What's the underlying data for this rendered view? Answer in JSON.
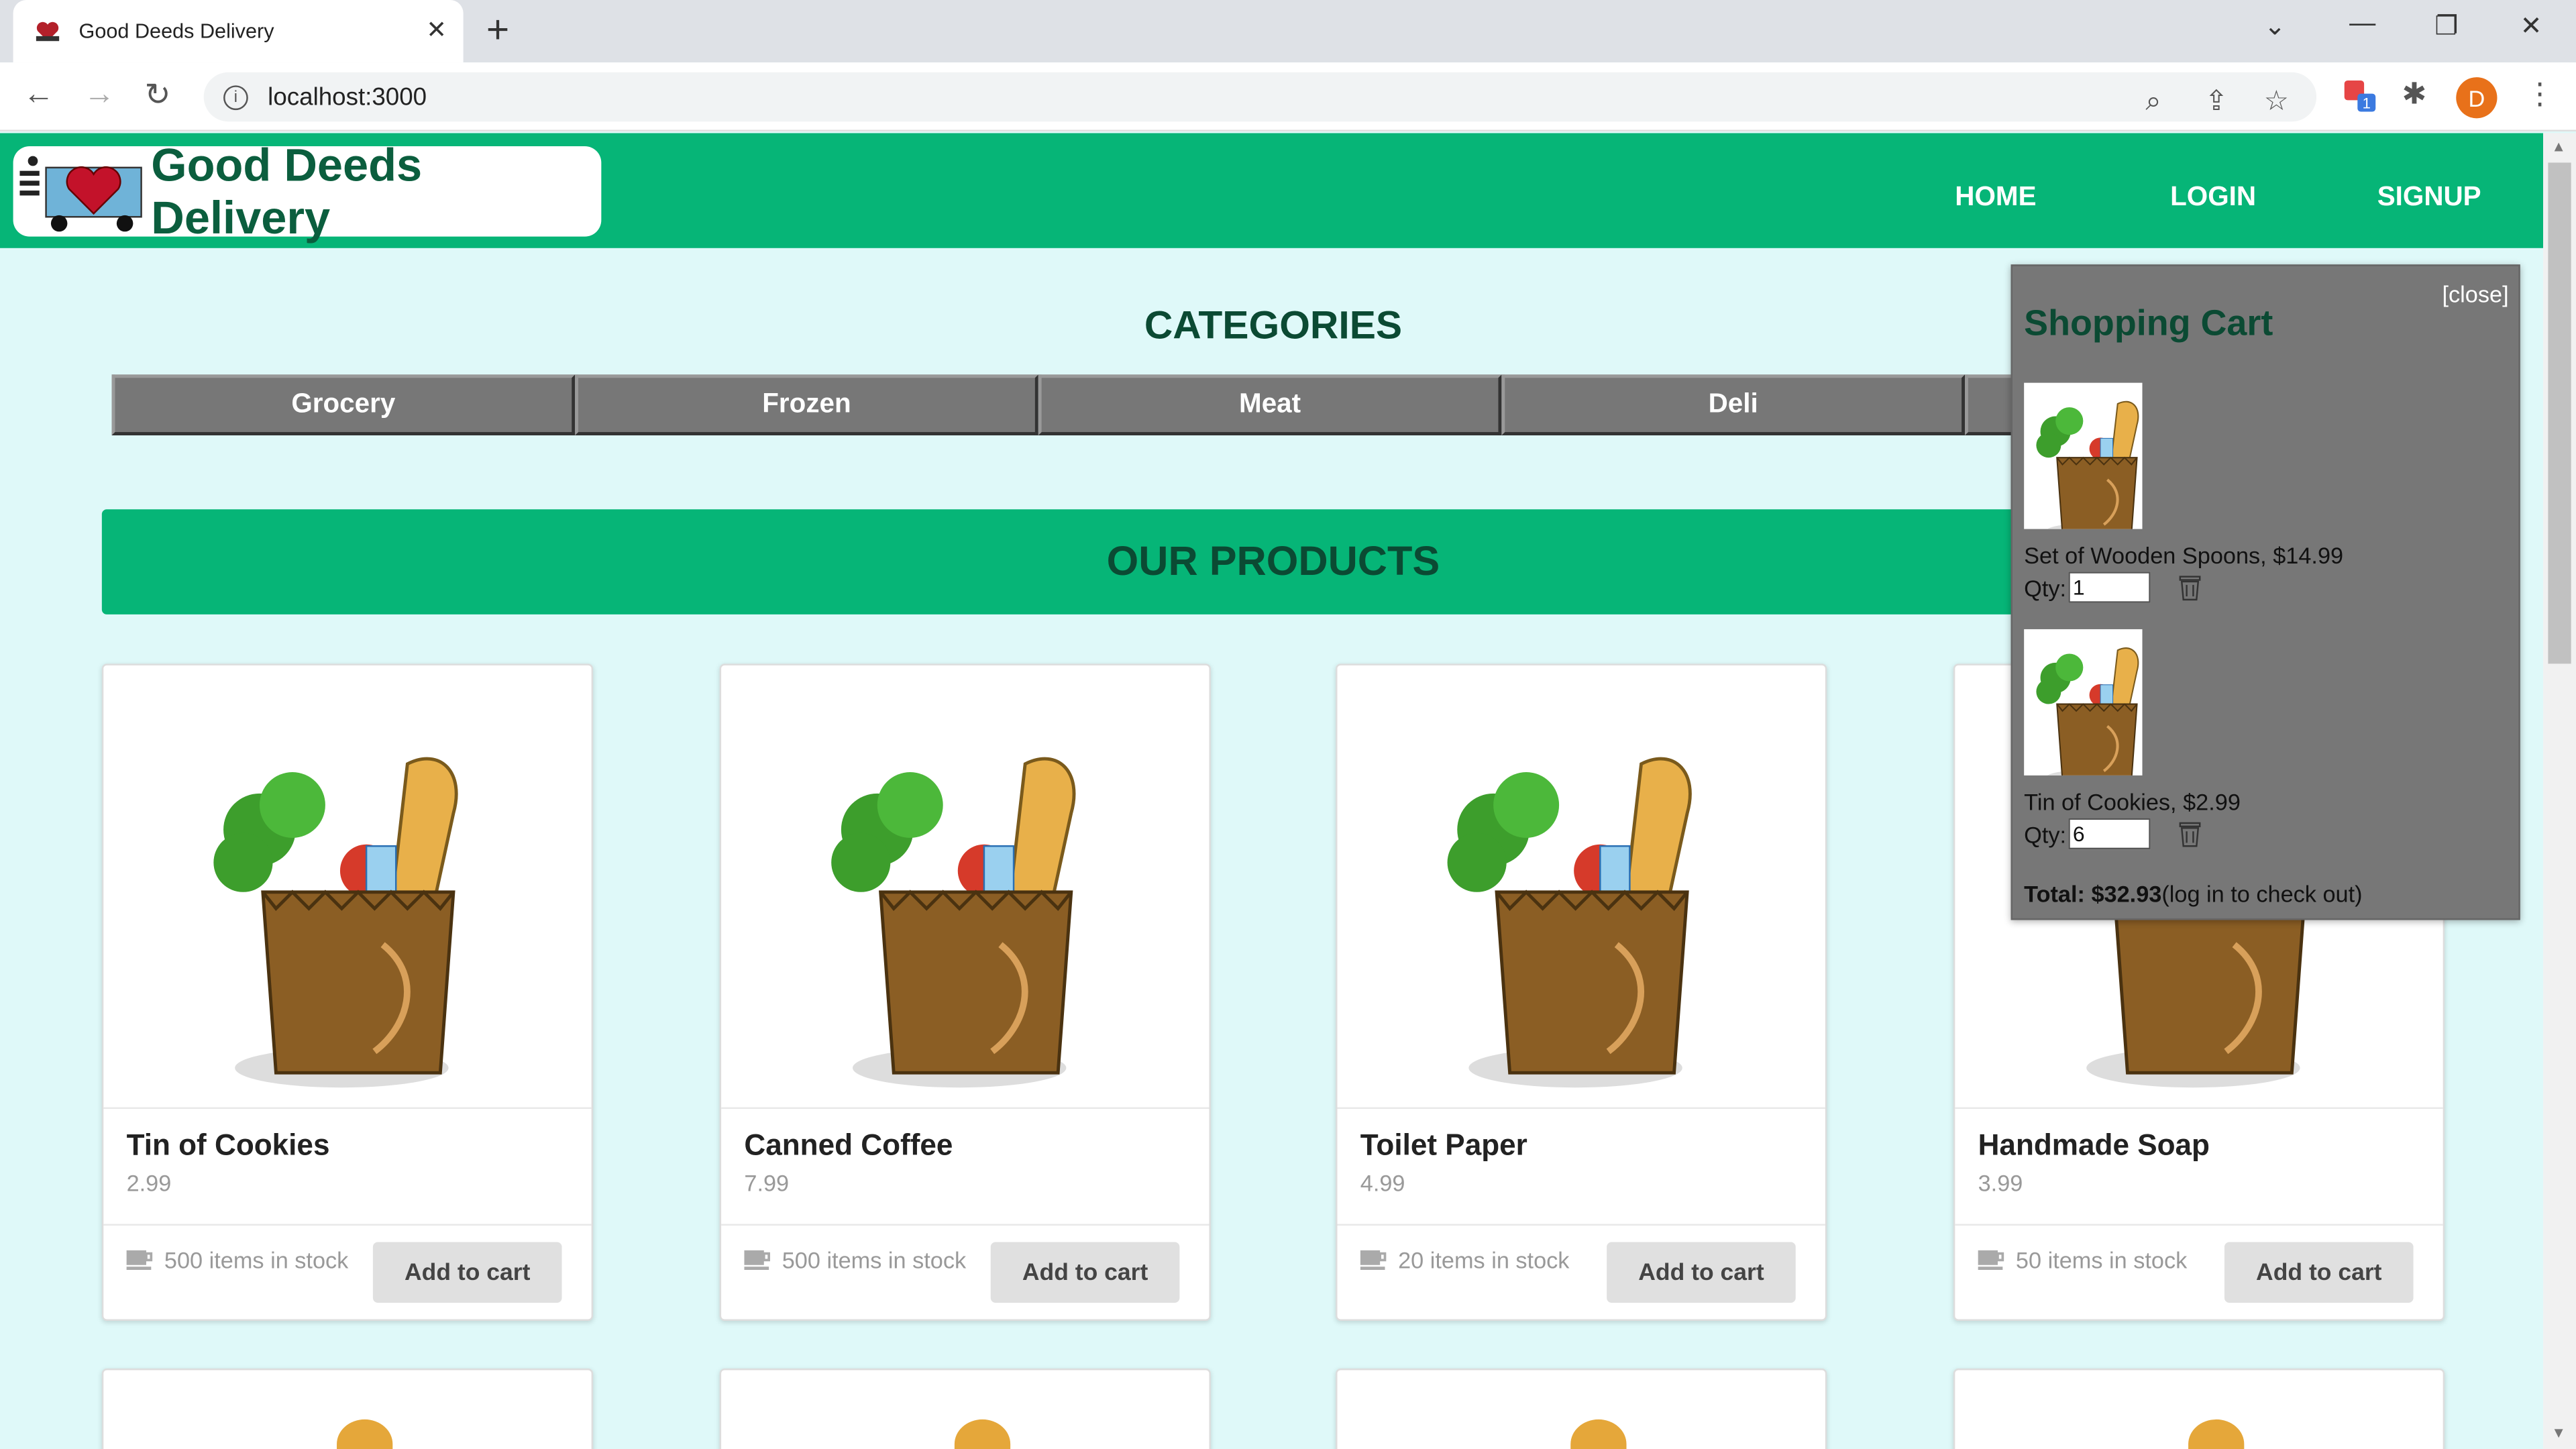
{
  "browser": {
    "tab_title": "Good Deeds Delivery",
    "url": "localhost:3000",
    "avatar_letter": "D",
    "extension_badge": "1"
  },
  "site": {
    "brand": "Good Deeds Delivery",
    "nav": [
      "HOME",
      "LOGIN",
      "SIGNUP"
    ],
    "accent": "#06b577"
  },
  "categories": {
    "title": "CATEGORIES",
    "items": [
      "Grocery",
      "Frozen",
      "Meat",
      "Deli"
    ]
  },
  "products": {
    "title": "OUR PRODUCTS",
    "add_label": "Add to cart",
    "items": [
      {
        "name": "Tin of Cookies",
        "price": "2.99",
        "stock": "500 items in stock"
      },
      {
        "name": "Canned Coffee",
        "price": "7.99",
        "stock": "500 items in stock"
      },
      {
        "name": "Toilet Paper",
        "price": "4.99",
        "stock": "20 items in stock"
      },
      {
        "name": "Handmade Soap",
        "price": "3.99",
        "stock": "50 items in stock"
      }
    ]
  },
  "cart": {
    "close_label": "[close]",
    "title": "Shopping Cart",
    "qty_label": "Qty:",
    "items": [
      {
        "label": "Set of Wooden Spoons, $14.99",
        "qty": "1"
      },
      {
        "label": "Tin of Cookies, $2.99",
        "qty": "6"
      }
    ],
    "total_label": "Total: $32.93",
    "checkout_note": "(log in to check out)"
  }
}
